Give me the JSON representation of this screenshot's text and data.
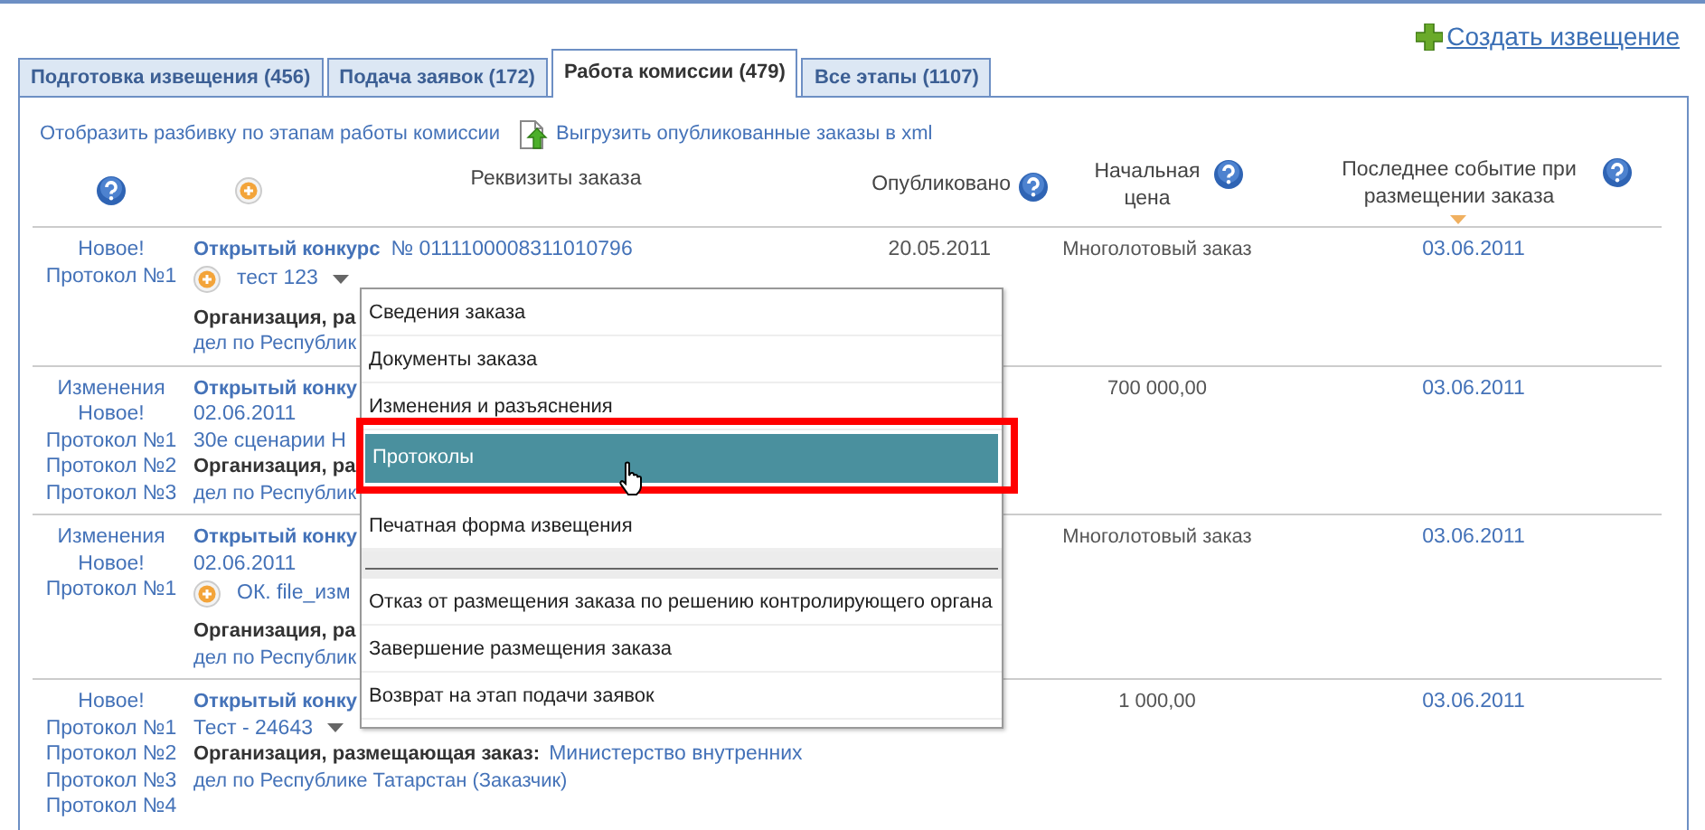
{
  "create_link": {
    "label": "Создать извещение"
  },
  "tabs": [
    {
      "label": "Подготовка извещения (456)",
      "selected": false
    },
    {
      "label": "Подача заявок (172)",
      "selected": false
    },
    {
      "label": "Работа комиссии (479)",
      "selected": true
    },
    {
      "label": "Все этапы (1107)",
      "selected": false
    }
  ],
  "panel_links": [
    {
      "label": "Отобразить разбивку по этапам работы комиссии",
      "kind": "plain"
    },
    {
      "label": "Выгрузить опубликованные заказы в xml",
      "kind": "export"
    }
  ],
  "table": {
    "columns": [
      {
        "kind": "help"
      },
      {
        "kind": "add"
      },
      {
        "kind": "label",
        "label": "Реквизиты заказа"
      },
      {
        "kind": "label",
        "label": "Опубликовано",
        "help": true
      },
      {
        "kind": "label",
        "label": "Начальная цена",
        "help": true
      },
      {
        "kind": "label",
        "label": "Последнее событие при размещении заказа",
        "help": true,
        "sorted": true
      }
    ],
    "rows": [
      {
        "events": [
          "Новое!",
          "Протокол №1"
        ],
        "title": "Открытый конкурс",
        "number": "№  0111100008311010796",
        "subject": {
          "text": "тест 123",
          "add_icon": true,
          "menu": true
        },
        "org_label": "Организация, ра",
        "org_rest": "дел по Республик",
        "published": "20.05.2011",
        "price": "Многолотовый заказ",
        "last_event": "03.06.2011"
      },
      {
        "events": [
          "Изменения",
          "Новое!",
          "Протокол №1",
          "Протокол №2",
          "Протокол №3"
        ],
        "title": "Открытый конку",
        "date": "02.06.2011",
        "subject": {
          "text": "30е сценарии Н"
        },
        "org_label": "Организация, ра",
        "org_rest": "дел по Республик",
        "price": "700 000,00",
        "last_event": "03.06.2011"
      },
      {
        "events": [
          "Изменения",
          "Новое!",
          "Протокол №1"
        ],
        "title": "Открытый конку",
        "date": "02.06.2011",
        "subject": {
          "text": "ОК. file_изм",
          "add_icon": true
        },
        "org_label": "Организация, ра",
        "org_rest": "дел по Республик",
        "price": "Многолотовый заказ",
        "last_event": "03.06.2011"
      },
      {
        "events": [
          "Новое!",
          "Протокол №1",
          "Протокол №2",
          "Протокол №3",
          "Протокол №4"
        ],
        "title": "Открытый конку",
        "subject": {
          "text": "Тест - 24643",
          "menu": true
        },
        "org_label": "Организация, размещающая заказ:",
        "org_value": "Министерство внутренних",
        "org_rest": "дел по Республике Татарстан (Заказчик)",
        "price": "1 000,00",
        "last_event": "03.06.2011"
      }
    ]
  },
  "context_menu": {
    "items": [
      {
        "kind": "item",
        "label": "Сведения заказа",
        "selected": false
      },
      {
        "kind": "item",
        "label": "Документы заказа",
        "selected": false
      },
      {
        "kind": "item",
        "label": "Изменения и разъяснения",
        "selected": false
      },
      {
        "kind": "item",
        "label": "Протоколы",
        "selected": true
      },
      {
        "kind": "item",
        "label": "Печатная форма извещения",
        "selected": false
      },
      {
        "kind": "separator"
      },
      {
        "kind": "item",
        "label": "Отказ от размещения заказа по решению контролирующего органа",
        "selected": false
      },
      {
        "kind": "item",
        "label": "Завершение размещения заказа",
        "selected": false
      },
      {
        "kind": "item",
        "label": "Возврат на этап подачи заявок",
        "selected": false
      }
    ]
  }
}
